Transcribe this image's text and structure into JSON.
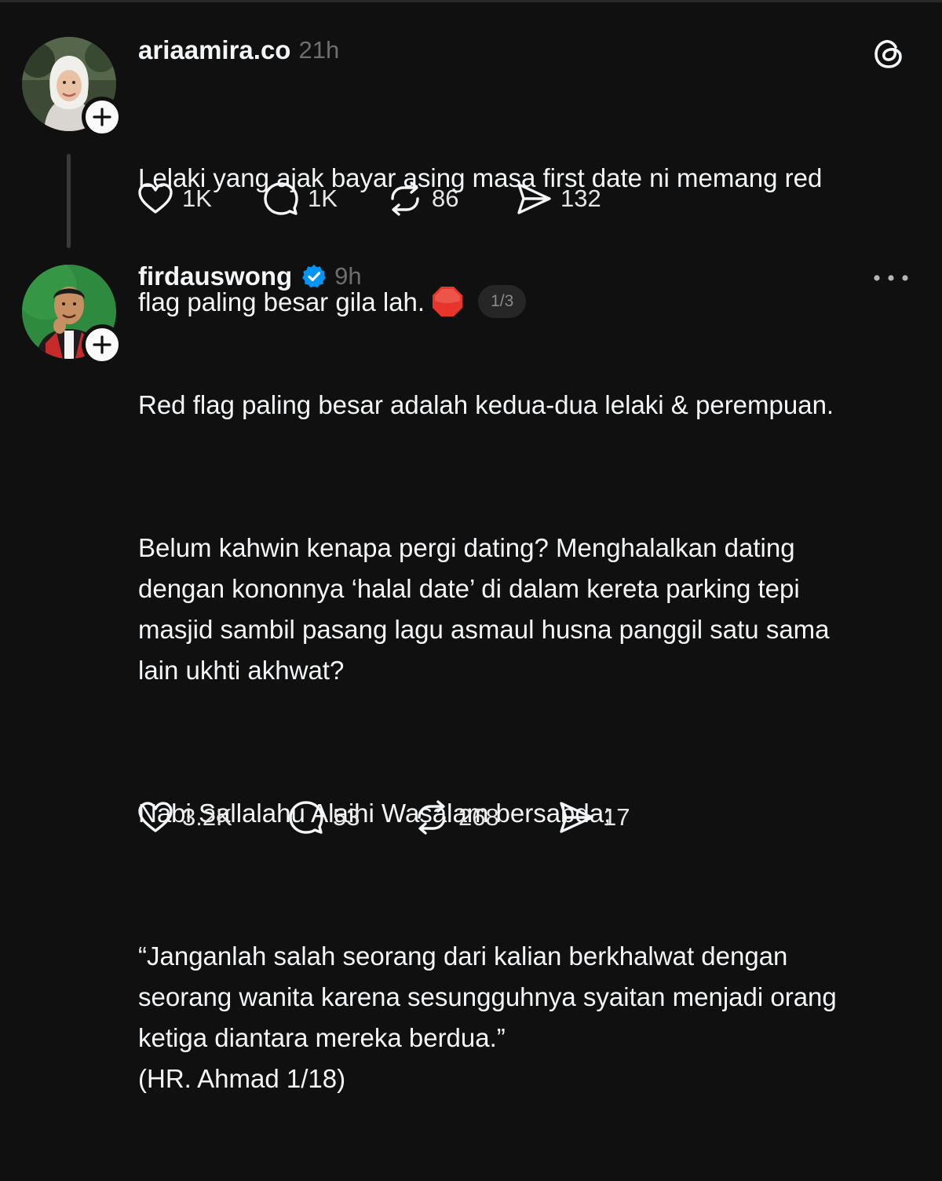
{
  "posts": [
    {
      "username": "ariaamira.co",
      "time": "21h",
      "verified": false,
      "text_lines": [
        "Lelaki yang ajak bayar asing masa first date ni memang red",
        "flag paling besar gila lah."
      ],
      "emoji": "stop-sign-emoji",
      "page_indicator": "1/3",
      "stats": {
        "likes": "1K",
        "replies": "1K",
        "reposts": "86",
        "shares": "132"
      }
    },
    {
      "username": "firdauswong",
      "time": "9h",
      "verified": true,
      "paragraphs": [
        "Red flag paling besar adalah kedua-dua lelaki & perempuan.",
        "Belum kahwin kenapa pergi dating? Menghalalkan dating\ndengan kononnya ‘halal date’ di dalam kereta parking tepi\nmasjid sambil pasang lagu asmaul husna panggil satu sama\nlain ukhti akhwat?",
        "Nabi Sallalahu Alaihi Wasalam bersabda;",
        "“Janganlah salah seorang dari kalian berkhalwat dengan\nseorang wanita karena sesungguhnya syaitan menjadi orang\nketiga diantara mereka berdua.”\n(HR. Ahmad 1/18)"
      ],
      "stats": {
        "likes": "3.2K",
        "replies": "53",
        "reposts": "268",
        "shares": "17"
      }
    }
  ],
  "colors": {
    "background": "#101010",
    "text": "#f3f5f7",
    "muted": "#6e6e6e",
    "verified": "#0095f6",
    "emoji_red": "#e8352c"
  }
}
